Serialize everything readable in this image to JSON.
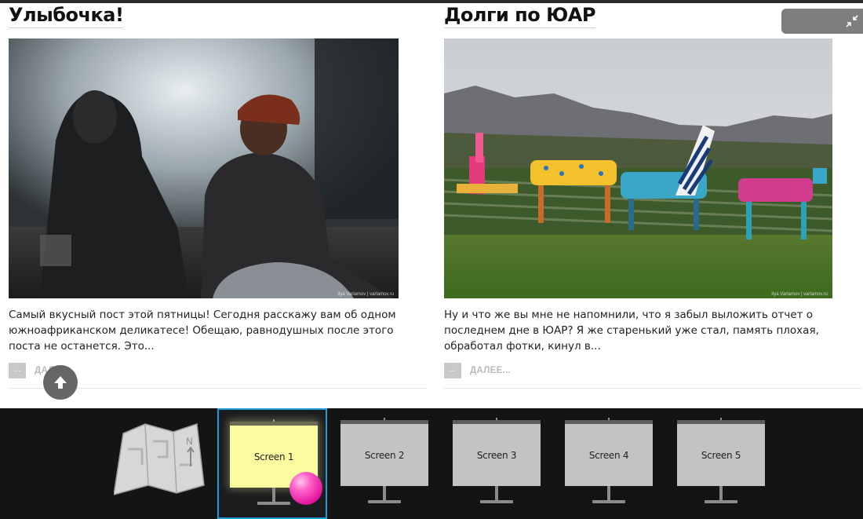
{
  "posts": [
    {
      "title": "Улыбочка!",
      "excerpt": "Самый вкусный пост этой пятницы! Сегодня расскажу вам об одном южноафриканском деликатесе! Обещаю, равнодушных после этого поста не останется. Это...",
      "more_label": "ДАЛЕЕ...",
      "more_box": "...",
      "photo_watermark": "Ilya Varlamov | varlamov.ru"
    },
    {
      "title": "Долги по ЮАР",
      "excerpt": "Ну и что же вы мне не напомнили, что я забыл выложить отчет о последнем дне в ЮАР? Я же старенький уже стал, память плохая, обработал фотки, кинул в...",
      "more_label": "ДАЛЕЕ...",
      "more_box": "...",
      "photo_watermark": "Ilya Varlamov | varlamov.ru"
    }
  ],
  "dock": {
    "screens": [
      {
        "label": "Screen 1",
        "active": true
      },
      {
        "label": "Screen 2",
        "active": false
      },
      {
        "label": "Screen 3",
        "active": false
      },
      {
        "label": "Screen 4",
        "active": false
      },
      {
        "label": "Screen 5",
        "active": false
      }
    ]
  },
  "icons": {
    "scroll_top": "arrow-up-icon",
    "collapse": "collapse-arrows-icon",
    "map": "map-icon"
  },
  "colors": {
    "active_screen_border": "#1f9bd6",
    "active_screen_fill": "#fbfba0",
    "user_marker": "#ff3fbf",
    "dock_background": "#141414"
  }
}
